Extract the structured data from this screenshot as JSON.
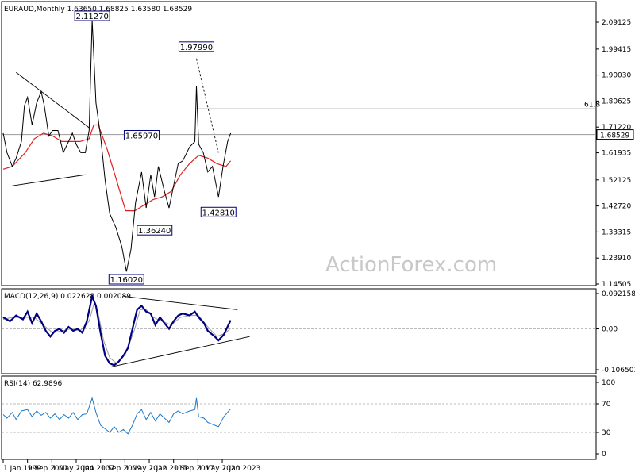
{
  "header": {
    "main": "EURAUD,Monthly  1.63650 1.68825 1.63580 1.68529",
    "macd": "MACD(12,26,9) 0.022628 0.002089",
    "rsi": "RSI(14) 62.9896"
  },
  "watermark": "ActionForex.com",
  "colors": {
    "price": "#000000",
    "ma": "#e02020",
    "macd_line": "#000080",
    "signal_line": "#9a9a9a",
    "rsi_line": "#1e78c8",
    "trendline": "#000000",
    "fib_line": "#000000",
    "label_box": "#000080",
    "background": "#ffffff"
  },
  "chart_data": [
    {
      "type": "line",
      "panel": "price",
      "title": "EURAUD,Monthly",
      "ohlc_last": {
        "open": 1.6365,
        "high": 1.68825,
        "low": 1.6358,
        "close": 1.68529
      },
      "x_tick_labels": [
        "1 Jan 1999",
        "1 Sep 2001",
        "1 May 2004",
        "1 Jan 2007",
        "1 Sep 2009",
        "1 May 2012",
        "1 Jan 2015",
        "1 Sep 2017",
        "1 May 2020",
        "1 Jan 2023"
      ],
      "y_tick_labels": [
        "2.09125",
        "1.99415",
        "1.90030",
        "1.80625",
        "1.71220",
        "1.61935",
        "1.52125",
        "1.42720",
        "1.33315",
        "1.23910",
        "1.14505"
      ],
      "ylim": [
        1.14505,
        2.09125
      ],
      "current_price_label": "1.68529",
      "fib_level_label": "61.8",
      "fib_level_value": 1.778,
      "price_labels": [
        {
          "text": "2.11270",
          "value": 2.1127,
          "date": "2008-10"
        },
        {
          "text": "1.97990",
          "value": 1.9799,
          "date": "2020-03"
        },
        {
          "text": "1.65970",
          "value": 1.6597,
          "date": "2014-03"
        },
        {
          "text": "1.36240",
          "value": 1.3624,
          "date": "2015-08"
        },
        {
          "text": "1.42810",
          "value": 1.4281,
          "date": "2022-08"
        },
        {
          "text": "1.16020",
          "value": 1.1602,
          "date": "2012-07"
        }
      ],
      "series": [
        {
          "name": "price",
          "points": [
            [
              "1999-01",
              1.69
            ],
            [
              "1999-06",
              1.62
            ],
            [
              "2000-01",
              1.57
            ],
            [
              "2000-06",
              1.6
            ],
            [
              "2001-01",
              1.66
            ],
            [
              "2001-05",
              1.79
            ],
            [
              "2001-09",
              1.82
            ],
            [
              "2002-03",
              1.72
            ],
            [
              "2002-09",
              1.8
            ],
            [
              "2003-03",
              1.84
            ],
            [
              "2003-07",
              1.79
            ],
            [
              "2004-01",
              1.68
            ],
            [
              "2004-06",
              1.7
            ],
            [
              "2005-01",
              1.7
            ],
            [
              "2005-08",
              1.62
            ],
            [
              "2006-03",
              1.66
            ],
            [
              "2006-08",
              1.69
            ],
            [
              "2007-01",
              1.65
            ],
            [
              "2007-07",
              1.62
            ],
            [
              "2008-01",
              1.62
            ],
            [
              "2008-06",
              1.7
            ],
            [
              "2008-10",
              2.1
            ],
            [
              "2009-03",
              1.8
            ],
            [
              "2009-09",
              1.68
            ],
            [
              "2010-03",
              1.52
            ],
            [
              "2010-09",
              1.4
            ],
            [
              "2011-05",
              1.35
            ],
            [
              "2012-01",
              1.28
            ],
            [
              "2012-07",
              1.19
            ],
            [
              "2013-01",
              1.27
            ],
            [
              "2013-07",
              1.44
            ],
            [
              "2014-03",
              1.55
            ],
            [
              "2014-09",
              1.42
            ],
            [
              "2015-03",
              1.54
            ],
            [
              "2015-08",
              1.46
            ],
            [
              "2016-01",
              1.57
            ],
            [
              "2016-09",
              1.48
            ],
            [
              "2017-03",
              1.42
            ],
            [
              "2017-09",
              1.5
            ],
            [
              "2018-03",
              1.58
            ],
            [
              "2018-09",
              1.59
            ],
            [
              "2019-06",
              1.64
            ],
            [
              "2020-01",
              1.66
            ],
            [
              "2020-03",
              1.86
            ],
            [
              "2020-06",
              1.65
            ],
            [
              "2020-12",
              1.62
            ],
            [
              "2021-06",
              1.55
            ],
            [
              "2021-12",
              1.57
            ],
            [
              "2022-08",
              1.46
            ],
            [
              "2023-02",
              1.57
            ],
            [
              "2023-08",
              1.66
            ],
            [
              "2023-12",
              1.69
            ]
          ]
        },
        {
          "name": "moving-average",
          "points": [
            [
              "1999-01",
              1.56
            ],
            [
              "2000-01",
              1.57
            ],
            [
              "2001-06",
              1.62
            ],
            [
              "2002-06",
              1.67
            ],
            [
              "2003-06",
              1.69
            ],
            [
              "2004-06",
              1.68
            ],
            [
              "2005-06",
              1.66
            ],
            [
              "2006-06",
              1.66
            ],
            [
              "2007-06",
              1.66
            ],
            [
              "2008-06",
              1.67
            ],
            [
              "2008-12",
              1.72
            ],
            [
              "2009-06",
              1.72
            ],
            [
              "2010-06",
              1.63
            ],
            [
              "2011-06",
              1.52
            ],
            [
              "2012-06",
              1.41
            ],
            [
              "2013-06",
              1.41
            ],
            [
              "2014-06",
              1.43
            ],
            [
              "2015-06",
              1.45
            ],
            [
              "2016-06",
              1.46
            ],
            [
              "2017-06",
              1.48
            ],
            [
              "2018-06",
              1.54
            ],
            [
              "2019-06",
              1.58
            ],
            [
              "2020-06",
              1.61
            ],
            [
              "2021-06",
              1.6
            ],
            [
              "2022-06",
              1.58
            ],
            [
              "2023-06",
              1.57
            ],
            [
              "2023-12",
              1.59
            ]
          ]
        }
      ]
    },
    {
      "type": "line",
      "panel": "macd",
      "title": "MACD(12,26,9)",
      "y_tick_labels": [
        "0.092158",
        "0.00",
        "-0.106503"
      ],
      "ylim": [
        -0.106503,
        0.092158
      ],
      "series": [
        {
          "name": "MACD",
          "points": [
            [
              "1999-01",
              0.03
            ],
            [
              "1999-10",
              0.02
            ],
            [
              "2000-06",
              0.035
            ],
            [
              "2001-03",
              0.025
            ],
            [
              "2001-09",
              0.045
            ],
            [
              "2002-03",
              0.015
            ],
            [
              "2002-09",
              0.04
            ],
            [
              "2003-03",
              0.02
            ],
            [
              "2003-09",
              -0.005
            ],
            [
              "2004-03",
              -0.02
            ],
            [
              "2004-09",
              -0.005
            ],
            [
              "2005-03",
              0.0
            ],
            [
              "2005-09",
              -0.01
            ],
            [
              "2006-03",
              0.005
            ],
            [
              "2006-09",
              -0.005
            ],
            [
              "2007-03",
              0.0
            ],
            [
              "2007-09",
              -0.01
            ],
            [
              "2008-03",
              0.02
            ],
            [
              "2008-10",
              0.085
            ],
            [
              "2009-03",
              0.06
            ],
            [
              "2009-09",
              -0.01
            ],
            [
              "2010-03",
              -0.07
            ],
            [
              "2010-09",
              -0.09
            ],
            [
              "2011-03",
              -0.095
            ],
            [
              "2011-09",
              -0.085
            ],
            [
              "2012-03",
              -0.07
            ],
            [
              "2012-09",
              -0.05
            ],
            [
              "2013-03",
              0.0
            ],
            [
              "2013-09",
              0.05
            ],
            [
              "2014-03",
              0.06
            ],
            [
              "2014-09",
              0.045
            ],
            [
              "2015-03",
              0.04
            ],
            [
              "2015-09",
              0.01
            ],
            [
              "2016-03",
              0.03
            ],
            [
              "2016-09",
              0.015
            ],
            [
              "2017-03",
              0.0
            ],
            [
              "2017-09",
              0.02
            ],
            [
              "2018-03",
              0.035
            ],
            [
              "2018-09",
              0.04
            ],
            [
              "2019-06",
              0.035
            ],
            [
              "2020-01",
              0.045
            ],
            [
              "2020-06",
              0.03
            ],
            [
              "2021-01",
              0.015
            ],
            [
              "2021-06",
              -0.005
            ],
            [
              "2022-03",
              -0.02
            ],
            [
              "2022-08",
              -0.03
            ],
            [
              "2023-03",
              -0.015
            ],
            [
              "2023-12",
              0.022628
            ]
          ]
        },
        {
          "name": "Signal",
          "points": [
            [
              "1999-01",
              0.025
            ],
            [
              "2000-01",
              0.03
            ],
            [
              "2001-06",
              0.03
            ],
            [
              "2002-06",
              0.03
            ],
            [
              "2003-06",
              0.01
            ],
            [
              "2004-06",
              -0.01
            ],
            [
              "2005-06",
              -0.005
            ],
            [
              "2006-06",
              0.0
            ],
            [
              "2007-06",
              -0.005
            ],
            [
              "2008-06",
              0.02
            ],
            [
              "2009-01",
              0.07
            ],
            [
              "2009-06",
              0.04
            ],
            [
              "2010-01",
              -0.03
            ],
            [
              "2010-09",
              -0.075
            ],
            [
              "2011-06",
              -0.09
            ],
            [
              "2012-06",
              -0.065
            ],
            [
              "2013-06",
              0.0
            ],
            [
              "2014-01",
              0.05
            ],
            [
              "2014-09",
              0.05
            ],
            [
              "2015-06",
              0.03
            ],
            [
              "2016-06",
              0.02
            ],
            [
              "2017-06",
              0.01
            ],
            [
              "2018-06",
              0.03
            ],
            [
              "2019-06",
              0.035
            ],
            [
              "2020-06",
              0.035
            ],
            [
              "2021-06",
              0.005
            ],
            [
              "2022-06",
              -0.02
            ],
            [
              "2023-06",
              -0.01
            ],
            [
              "2023-12",
              0.002089
            ]
          ]
        }
      ]
    },
    {
      "type": "line",
      "panel": "rsi",
      "title": "RSI(14)",
      "y_tick_labels": [
        "100",
        "70",
        "30",
        "0"
      ],
      "ylim": [
        0,
        100
      ],
      "levels": [
        70,
        30
      ],
      "series": [
        {
          "name": "RSI",
          "points": [
            [
              "1999-01",
              55
            ],
            [
              "1999-06",
              50
            ],
            [
              "2000-01",
              58
            ],
            [
              "2000-06",
              48
            ],
            [
              "2001-01",
              60
            ],
            [
              "2001-09",
              62
            ],
            [
              "2002-03",
              52
            ],
            [
              "2002-09",
              60
            ],
            [
              "2003-03",
              54
            ],
            [
              "2003-09",
              58
            ],
            [
              "2004-03",
              50
            ],
            [
              "2004-09",
              56
            ],
            [
              "2005-03",
              48
            ],
            [
              "2005-09",
              55
            ],
            [
              "2006-03",
              50
            ],
            [
              "2006-09",
              58
            ],
            [
              "2007-03",
              48
            ],
            [
              "2007-09",
              55
            ],
            [
              "2008-03",
              56
            ],
            [
              "2008-10",
              78
            ],
            [
              "2009-03",
              58
            ],
            [
              "2009-09",
              40
            ],
            [
              "2010-03",
              35
            ],
            [
              "2010-09",
              30
            ],
            [
              "2011-03",
              38
            ],
            [
              "2011-09",
              30
            ],
            [
              "2012-03",
              34
            ],
            [
              "2012-09",
              28
            ],
            [
              "2013-03",
              40
            ],
            [
              "2013-09",
              56
            ],
            [
              "2014-03",
              62
            ],
            [
              "2014-09",
              48
            ],
            [
              "2015-03",
              58
            ],
            [
              "2015-09",
              46
            ],
            [
              "2016-03",
              56
            ],
            [
              "2016-09",
              50
            ],
            [
              "2017-03",
              44
            ],
            [
              "2017-09",
              56
            ],
            [
              "2018-03",
              60
            ],
            [
              "2018-09",
              56
            ],
            [
              "2019-06",
              60
            ],
            [
              "2020-01",
              62
            ],
            [
              "2020-03",
              78
            ],
            [
              "2020-06",
              52
            ],
            [
              "2021-01",
              50
            ],
            [
              "2021-06",
              44
            ],
            [
              "2022-03",
              40
            ],
            [
              "2022-08",
              38
            ],
            [
              "2023-03",
              52
            ],
            [
              "2023-12",
              62.9896
            ]
          ]
        }
      ]
    }
  ]
}
